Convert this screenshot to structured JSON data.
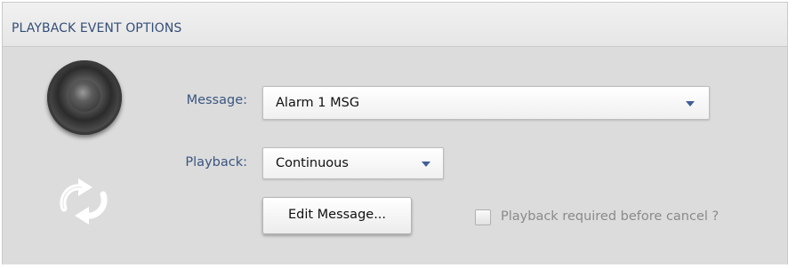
{
  "panel": {
    "title": "PLAYBACK EVENT OPTIONS"
  },
  "icons": {
    "speaker": "speaker-icon",
    "loop": "loop-icon"
  },
  "message": {
    "label": "Message:",
    "selected": "Alarm 1 MSG"
  },
  "playback": {
    "label": "Playback:",
    "selected": "Continuous"
  },
  "edit_button": {
    "label": "Edit Message..."
  },
  "playback_required": {
    "label": "Playback required before cancel ?",
    "checked": false
  },
  "colors": {
    "label_text": "#3a5580",
    "title_text": "#344f78",
    "panel_bg": "#dcdcdc",
    "arrow": "#3f5f96"
  }
}
